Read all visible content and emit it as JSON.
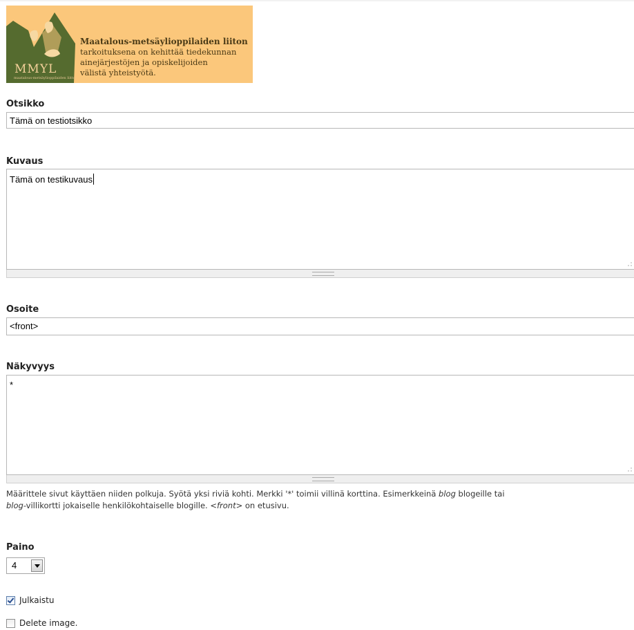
{
  "banner": {
    "logo_text": "MMYL",
    "logo_subtext": "maatalous-metsäylioppilaiden liitto",
    "title": "Maatalous-metsäylioppilaiden liiton",
    "lines": [
      "tarkoituksena on kehittää tiedekunnan",
      "ainejärjestöjen ja opiskelijoiden",
      "välistä yhteistyötä."
    ]
  },
  "title_field": {
    "label": "Otsikko",
    "value": "Tämä on testiotsikko"
  },
  "description_field": {
    "label": "Kuvaus",
    "value": "Tämä on testikuvaus"
  },
  "address_field": {
    "label": "Osoite",
    "value": "<front>"
  },
  "visibility_field": {
    "label": "Näkyvyys",
    "value": "*",
    "help_1": "Määrittele sivut käyttäen niiden polkuja. Syötä yksi riviä kohti. Merkki '*' toimii villinä korttina. Esimerkkeinä ",
    "help_blog1": "blog",
    "help_2": " blogeille tai",
    "help_blog2": "blog",
    "help_3": "-villikortti jokaiselle henkilökohtaiselle blogille. ",
    "help_front": "<front>",
    "help_4": " on etusivu."
  },
  "weight_field": {
    "label": "Paino",
    "value": "4"
  },
  "published": {
    "label": "Julkaistu",
    "checked": true
  },
  "delete_image": {
    "label": "Delete image.",
    "checked": false
  }
}
